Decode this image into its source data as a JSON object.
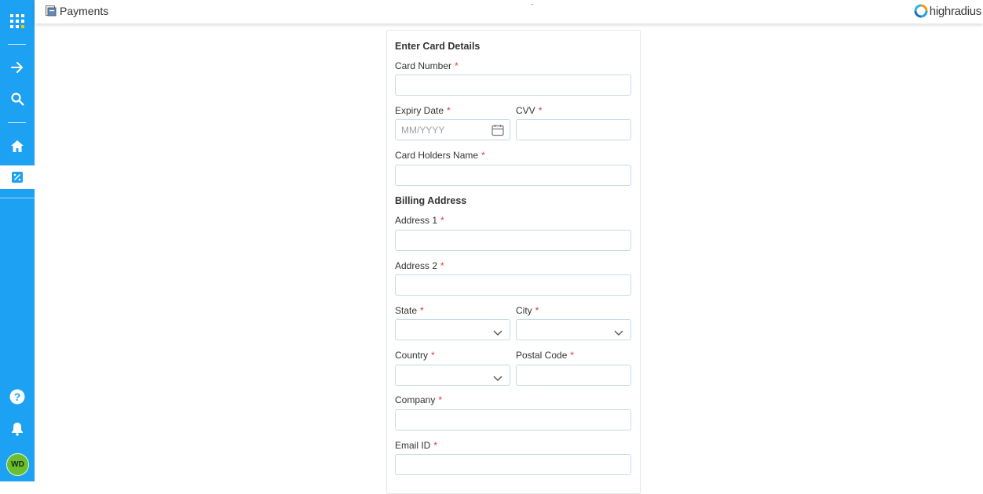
{
  "header": {
    "app_title": "Payments",
    "logo_text": "highradius"
  },
  "sidebar": {
    "items": [
      {
        "icon": "apps-grid-icon"
      },
      {
        "icon": "arrow-right-icon"
      },
      {
        "icon": "search-icon"
      },
      {
        "icon": "home-icon"
      },
      {
        "icon": "percent-icon",
        "active": true
      },
      {
        "icon": "help-icon"
      },
      {
        "icon": "bell-icon"
      }
    ],
    "avatar_initials": "WD"
  },
  "form": {
    "card_section_title": "Enter Card Details",
    "card_number": {
      "label": "Card Number",
      "value": ""
    },
    "expiry_date": {
      "label": "Expiry Date",
      "placeholder": "MM/YYYY",
      "value": ""
    },
    "cvv": {
      "label": "CVV",
      "value": ""
    },
    "card_holder_name": {
      "label": "Card Holders Name",
      "value": ""
    },
    "billing_section_title": "Billing Address",
    "address1": {
      "label": "Address 1",
      "value": ""
    },
    "address2": {
      "label": "Address 2",
      "value": ""
    },
    "state": {
      "label": "State",
      "value": ""
    },
    "city": {
      "label": "City",
      "value": ""
    },
    "country": {
      "label": "Country",
      "value": ""
    },
    "postal_code": {
      "label": "Postal Code",
      "value": ""
    },
    "company": {
      "label": "Company",
      "value": ""
    },
    "email_id": {
      "label": "Email ID",
      "value": ""
    },
    "required_marker": "*"
  },
  "colors": {
    "sidebar": "#1da1f2",
    "required": "#e53935",
    "field_border": "#c5dbe8",
    "avatar": "#6abf2f"
  }
}
